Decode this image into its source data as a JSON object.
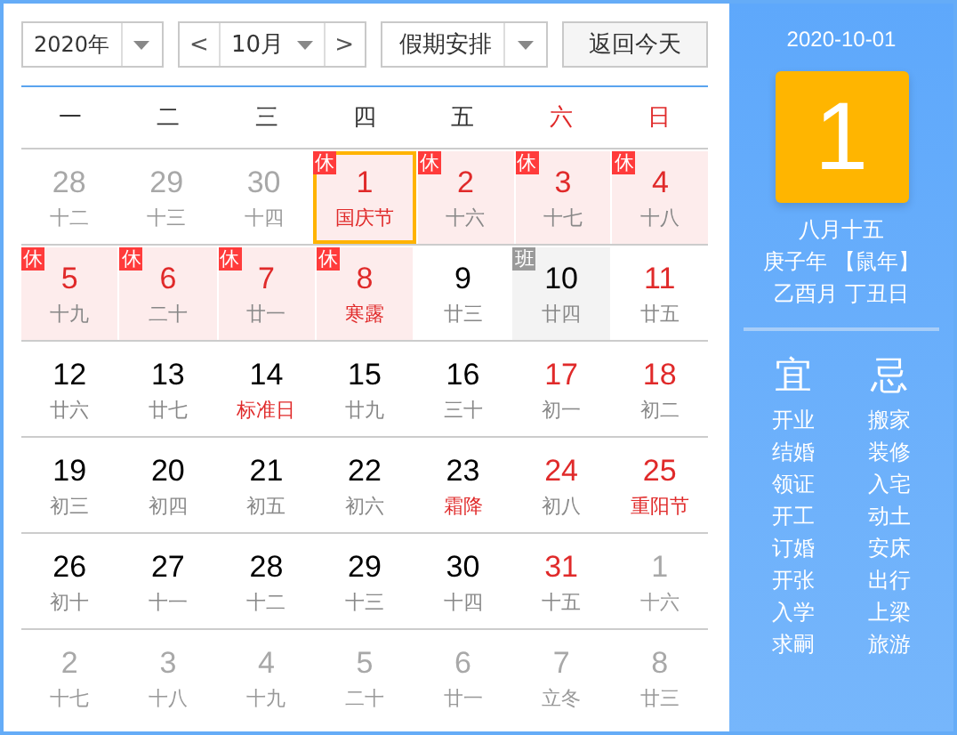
{
  "toolbar": {
    "year": "2020年",
    "prev": "<",
    "month": "10月",
    "next": ">",
    "holiday_select": "假期安排",
    "today_button": "返回今天"
  },
  "weekdays": [
    {
      "label": "一",
      "weekend": false
    },
    {
      "label": "二",
      "weekend": false
    },
    {
      "label": "三",
      "weekend": false
    },
    {
      "label": "四",
      "weekend": false
    },
    {
      "label": "五",
      "weekend": false
    },
    {
      "label": "六",
      "weekend": true
    },
    {
      "label": "日",
      "weekend": true
    }
  ],
  "weeks": [
    [
      {
        "day": "28",
        "lunar": "十二",
        "muted": true,
        "kind": "plain",
        "selected": false
      },
      {
        "day": "29",
        "lunar": "十三",
        "muted": true,
        "kind": "plain",
        "selected": false
      },
      {
        "day": "30",
        "lunar": "十四",
        "muted": true,
        "kind": "plain",
        "selected": false
      },
      {
        "day": "1",
        "lunar": "国庆节",
        "muted": false,
        "red_number": true,
        "red_lunar": true,
        "kind": "rest",
        "badge": "休",
        "selected": true
      },
      {
        "day": "2",
        "lunar": "十六",
        "muted": false,
        "red_number": true,
        "red_lunar": false,
        "kind": "rest",
        "badge": "休",
        "selected": false
      },
      {
        "day": "3",
        "lunar": "十七",
        "muted": false,
        "red_number": true,
        "red_lunar": false,
        "kind": "rest",
        "badge": "休",
        "selected": false
      },
      {
        "day": "4",
        "lunar": "十八",
        "muted": false,
        "red_number": true,
        "red_lunar": false,
        "kind": "rest",
        "badge": "休",
        "selected": false
      }
    ],
    [
      {
        "day": "5",
        "lunar": "十九",
        "muted": false,
        "red_number": true,
        "red_lunar": false,
        "kind": "rest",
        "badge": "休",
        "selected": false
      },
      {
        "day": "6",
        "lunar": "二十",
        "muted": false,
        "red_number": true,
        "red_lunar": false,
        "kind": "rest",
        "badge": "休",
        "selected": false
      },
      {
        "day": "7",
        "lunar": "廿一",
        "muted": false,
        "red_number": true,
        "red_lunar": false,
        "kind": "rest",
        "badge": "休",
        "selected": false
      },
      {
        "day": "8",
        "lunar": "寒露",
        "muted": false,
        "red_number": true,
        "red_lunar": true,
        "kind": "rest",
        "badge": "休",
        "selected": false
      },
      {
        "day": "9",
        "lunar": "廿三",
        "muted": false,
        "red_number": false,
        "red_lunar": false,
        "kind": "plain",
        "selected": false
      },
      {
        "day": "10",
        "lunar": "廿四",
        "muted": false,
        "red_number": false,
        "red_lunar": false,
        "kind": "work",
        "badge": "班",
        "selected": false
      },
      {
        "day": "11",
        "lunar": "廿五",
        "muted": false,
        "red_number": true,
        "red_lunar": false,
        "kind": "plain",
        "selected": false
      }
    ],
    [
      {
        "day": "12",
        "lunar": "廿六",
        "muted": false,
        "red_number": false,
        "red_lunar": false,
        "kind": "plain",
        "selected": false
      },
      {
        "day": "13",
        "lunar": "廿七",
        "muted": false,
        "red_number": false,
        "red_lunar": false,
        "kind": "plain",
        "selected": false
      },
      {
        "day": "14",
        "lunar": "标准日",
        "muted": false,
        "red_number": false,
        "red_lunar": true,
        "kind": "plain",
        "selected": false
      },
      {
        "day": "15",
        "lunar": "廿九",
        "muted": false,
        "red_number": false,
        "red_lunar": false,
        "kind": "plain",
        "selected": false
      },
      {
        "day": "16",
        "lunar": "三十",
        "muted": false,
        "red_number": false,
        "red_lunar": false,
        "kind": "plain",
        "selected": false
      },
      {
        "day": "17",
        "lunar": "初一",
        "muted": false,
        "red_number": true,
        "red_lunar": false,
        "kind": "plain",
        "selected": false
      },
      {
        "day": "18",
        "lunar": "初二",
        "muted": false,
        "red_number": true,
        "red_lunar": false,
        "kind": "plain",
        "selected": false
      }
    ],
    [
      {
        "day": "19",
        "lunar": "初三",
        "muted": false,
        "red_number": false,
        "red_lunar": false,
        "kind": "plain",
        "selected": false
      },
      {
        "day": "20",
        "lunar": "初四",
        "muted": false,
        "red_number": false,
        "red_lunar": false,
        "kind": "plain",
        "selected": false
      },
      {
        "day": "21",
        "lunar": "初五",
        "muted": false,
        "red_number": false,
        "red_lunar": false,
        "kind": "plain",
        "selected": false
      },
      {
        "day": "22",
        "lunar": "初六",
        "muted": false,
        "red_number": false,
        "red_lunar": false,
        "kind": "plain",
        "selected": false
      },
      {
        "day": "23",
        "lunar": "霜降",
        "muted": false,
        "red_number": false,
        "red_lunar": true,
        "kind": "plain",
        "selected": false
      },
      {
        "day": "24",
        "lunar": "初八",
        "muted": false,
        "red_number": true,
        "red_lunar": false,
        "kind": "plain",
        "selected": false
      },
      {
        "day": "25",
        "lunar": "重阳节",
        "muted": false,
        "red_number": true,
        "red_lunar": true,
        "kind": "plain",
        "selected": false
      }
    ],
    [
      {
        "day": "26",
        "lunar": "初十",
        "muted": false,
        "red_number": false,
        "red_lunar": false,
        "kind": "plain",
        "selected": false
      },
      {
        "day": "27",
        "lunar": "十一",
        "muted": false,
        "red_number": false,
        "red_lunar": false,
        "kind": "plain",
        "selected": false
      },
      {
        "day": "28",
        "lunar": "十二",
        "muted": false,
        "red_number": false,
        "red_lunar": false,
        "kind": "plain",
        "selected": false
      },
      {
        "day": "29",
        "lunar": "十三",
        "muted": false,
        "red_number": false,
        "red_lunar": false,
        "kind": "plain",
        "selected": false
      },
      {
        "day": "30",
        "lunar": "十四",
        "muted": false,
        "red_number": false,
        "red_lunar": false,
        "kind": "plain",
        "selected": false
      },
      {
        "day": "31",
        "lunar": "十五",
        "muted": false,
        "red_number": true,
        "red_lunar": false,
        "kind": "plain",
        "selected": false
      },
      {
        "day": "1",
        "lunar": "十六",
        "muted": true,
        "kind": "plain",
        "selected": false
      }
    ],
    [
      {
        "day": "2",
        "lunar": "十七",
        "muted": true,
        "kind": "plain",
        "selected": false
      },
      {
        "day": "3",
        "lunar": "十八",
        "muted": true,
        "kind": "plain",
        "selected": false
      },
      {
        "day": "4",
        "lunar": "十九",
        "muted": true,
        "kind": "plain",
        "selected": false
      },
      {
        "day": "5",
        "lunar": "二十",
        "muted": true,
        "kind": "plain",
        "selected": false
      },
      {
        "day": "6",
        "lunar": "廿一",
        "muted": true,
        "kind": "plain",
        "selected": false
      },
      {
        "day": "7",
        "lunar": "立冬",
        "muted": true,
        "kind": "plain",
        "selected": false
      },
      {
        "day": "8",
        "lunar": "廿三",
        "muted": true,
        "kind": "plain",
        "selected": false
      }
    ]
  ],
  "detail": {
    "date": "2020-10-01",
    "big_day": "1",
    "lunar_date": "八月十五",
    "year_line": "庚子年 【鼠年】",
    "month_day_line": "乙酉月 丁丑日",
    "suitable": {
      "title": "宜",
      "items": [
        "开业",
        "结婚",
        "领证",
        "开工",
        "订婚",
        "开张",
        "入学",
        "求嗣"
      ]
    },
    "avoid": {
      "title": "忌",
      "items": [
        "搬家",
        "装修",
        "入宅",
        "动土",
        "安床",
        "出行",
        "上梁",
        "旅游"
      ]
    }
  }
}
